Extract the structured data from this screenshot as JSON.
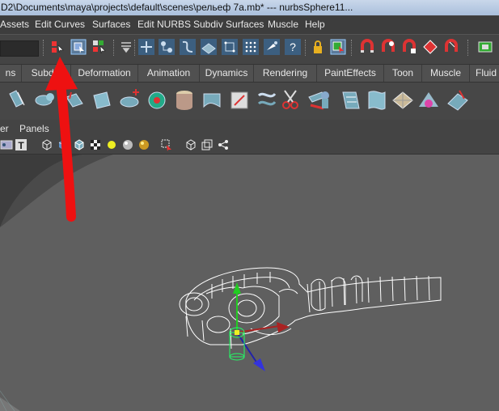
{
  "window": {
    "title": "D2\\Documents\\maya\\projects\\default\\scenes\\рельеф 7a.mb*   ---   nurbsSphere11..."
  },
  "main_menu": {
    "items": [
      "Assets",
      "Edit Curves",
      "Surfaces",
      "Edit NURBS",
      "Subdiv Surfaces",
      "Muscle",
      "Help"
    ]
  },
  "shelf_tabs": {
    "items": [
      "ns",
      "Subdiv",
      "Deformation",
      "Animation",
      "Dynamics",
      "Rendering",
      "PaintEffects",
      "Toon",
      "Muscle",
      "Fluid"
    ]
  },
  "panel_menu": {
    "items": [
      "er",
      "Panels"
    ]
  },
  "status_line": {
    "icons": [
      "select-by-hierarchy-icon",
      "select-by-object-type-icon",
      "select-by-component-type-icon",
      "menu-collapse-icon",
      "snap-to-grid-icon",
      "snap-to-curve-icon",
      "snap-to-point-icon",
      "snap-to-view-plane-icon",
      "make-live-icon",
      "history-icon",
      "render-icon",
      "lock-icon",
      "select-highlight-icon",
      "magnet-icon",
      "ipr-render-icon",
      "render-settings-icon",
      "hypershade-icon",
      "show-window-icon"
    ]
  },
  "colors": {
    "titlebar_bg": "#b8cbe4",
    "menu_bg": "#3d3d3d",
    "viewport_bg": "#3f3f3f",
    "annotation_arrow": "#ee1111",
    "wire_color": "#ffffff"
  }
}
